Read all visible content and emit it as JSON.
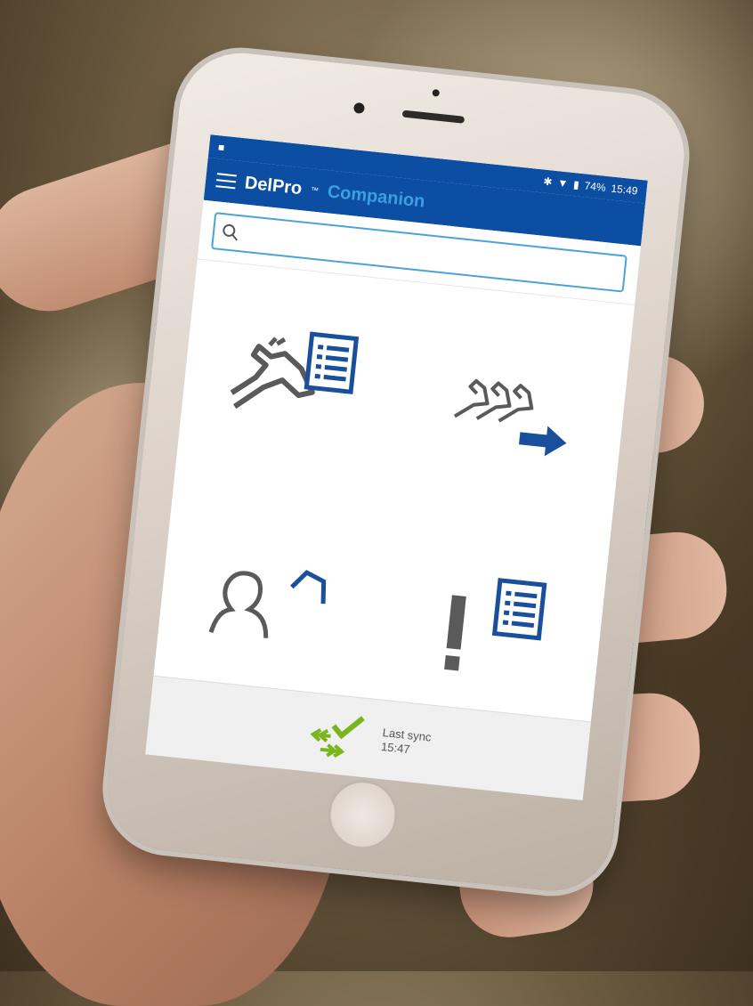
{
  "status_bar": {
    "battery": "74%",
    "time": "15:49"
  },
  "app_bar": {
    "brand": "DelPro",
    "brand_mark": "™",
    "product": "Companion"
  },
  "search": {
    "value": "",
    "placeholder": ""
  },
  "tiles": [
    {
      "icon": "animal-list-icon"
    },
    {
      "icon": "animal-move-icon"
    },
    {
      "icon": "user-farm-icon"
    },
    {
      "icon": "alarm-list-icon"
    }
  ],
  "footer": {
    "sync_label": "Last sync",
    "sync_time": "15:47"
  },
  "colors": {
    "app_bar": "#0b4ea2",
    "accent": "#3aa0e0",
    "sync_green": "#7ab51d",
    "icon_gray": "#5a5a5a"
  }
}
